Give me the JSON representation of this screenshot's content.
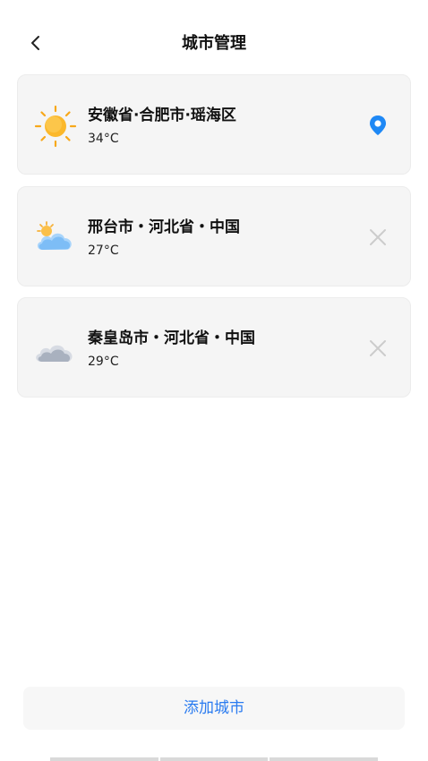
{
  "header": {
    "back_icon": "chevron-left-icon",
    "title": "城市管理"
  },
  "cities": [
    {
      "name": "安徽省·合肥市·瑶海区",
      "temp": "34°C",
      "weather_icon": "sun-icon",
      "action_icon": "location-pin-icon",
      "accent": "#1e88f5"
    },
    {
      "name": "邢台市・河北省・中国",
      "temp": "27°C",
      "weather_icon": "partly-cloudy-icon",
      "action_icon": "close-icon"
    },
    {
      "name": "秦皇岛市・河北省・中国",
      "temp": "29°C",
      "weather_icon": "cloudy-icon",
      "action_icon": "close-icon"
    }
  ],
  "add_city_label": "添加城市",
  "colors": {
    "accent": "#2a7bf0",
    "card_bg": "#f5f5f5"
  }
}
